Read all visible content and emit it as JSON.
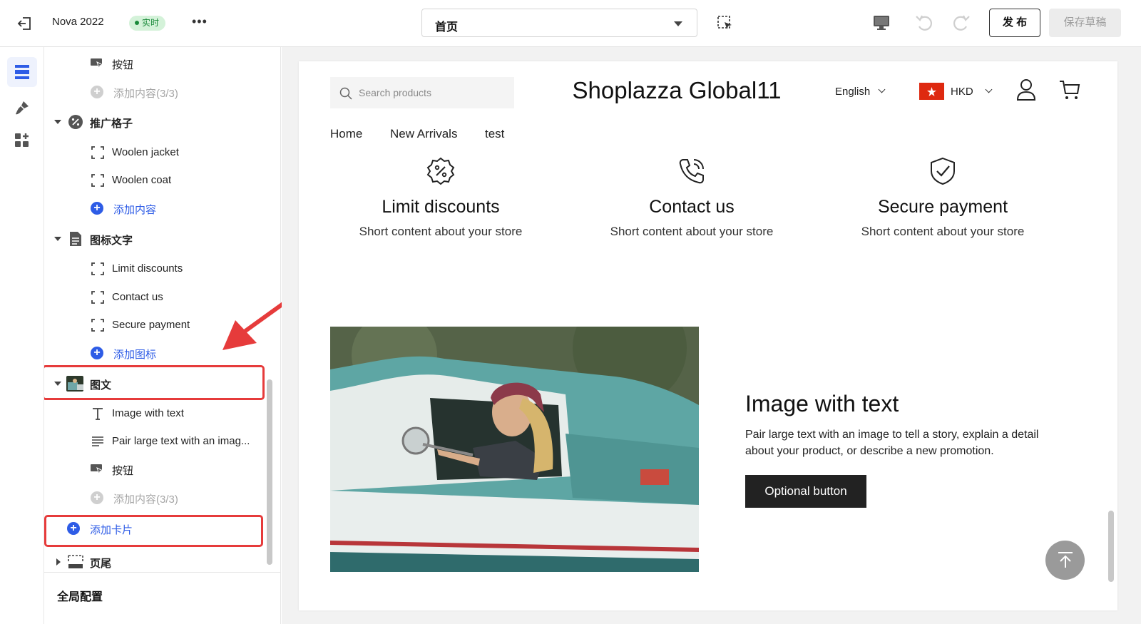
{
  "header": {
    "app_title": "Nova 2022",
    "live_badge": "实时",
    "more_label": "•••",
    "page_select_value": "首页",
    "publish_label": "发 布",
    "save_draft_label": "保存草稿"
  },
  "rail": {
    "items": [
      {
        "icon": "sections-icon",
        "active": true
      },
      {
        "icon": "theme-brush-icon",
        "active": false
      },
      {
        "icon": "apps-grid-icon",
        "active": false
      }
    ]
  },
  "tree": {
    "button_item_1": "按钮",
    "add_content_full_1": "添加内容(3/3)",
    "promo_grid": "推广格子",
    "woolen_jacket": "Woolen jacket",
    "woolen_coat": "Woolen coat",
    "add_content": "添加内容",
    "icon_text": "图标文字",
    "limit_discounts": "Limit discounts",
    "contact_us": "Contact us",
    "secure_payment": "Secure payment",
    "add_icon": "添加图标",
    "image_text": "图文",
    "image_with_text": "Image with text",
    "pair_large_text": "Pair large text with an imag...",
    "button_item_2": "按钮",
    "add_content_full_2": "添加内容(3/3)",
    "add_card": "添加卡片",
    "footer": "页尾",
    "global_config": "全局配置"
  },
  "store": {
    "search_placeholder": "Search products",
    "name": "Shoplazza Global11",
    "language": "English",
    "currency": "HKD",
    "nav": [
      "Home",
      "New Arrivals",
      "test"
    ],
    "features": [
      {
        "icon": "discount-badge-icon",
        "title": "Limit discounts",
        "text": "Short content about your store"
      },
      {
        "icon": "phone-ring-icon",
        "title": "Contact us",
        "text": "Short content about your store"
      },
      {
        "icon": "shield-check-icon",
        "title": "Secure payment",
        "text": "Short content about your store"
      }
    ],
    "image_with_text": {
      "title": "Image with text",
      "text": "Pair large text with an image to tell a story, explain a detail about your product, or describe a new promotion.",
      "button": "Optional button"
    }
  },
  "colors": {
    "accent_blue": "#2e5ce6",
    "highlight_red": "#e63b3b",
    "live_green": "#1a8a3a",
    "flag_red": "#de2910"
  }
}
